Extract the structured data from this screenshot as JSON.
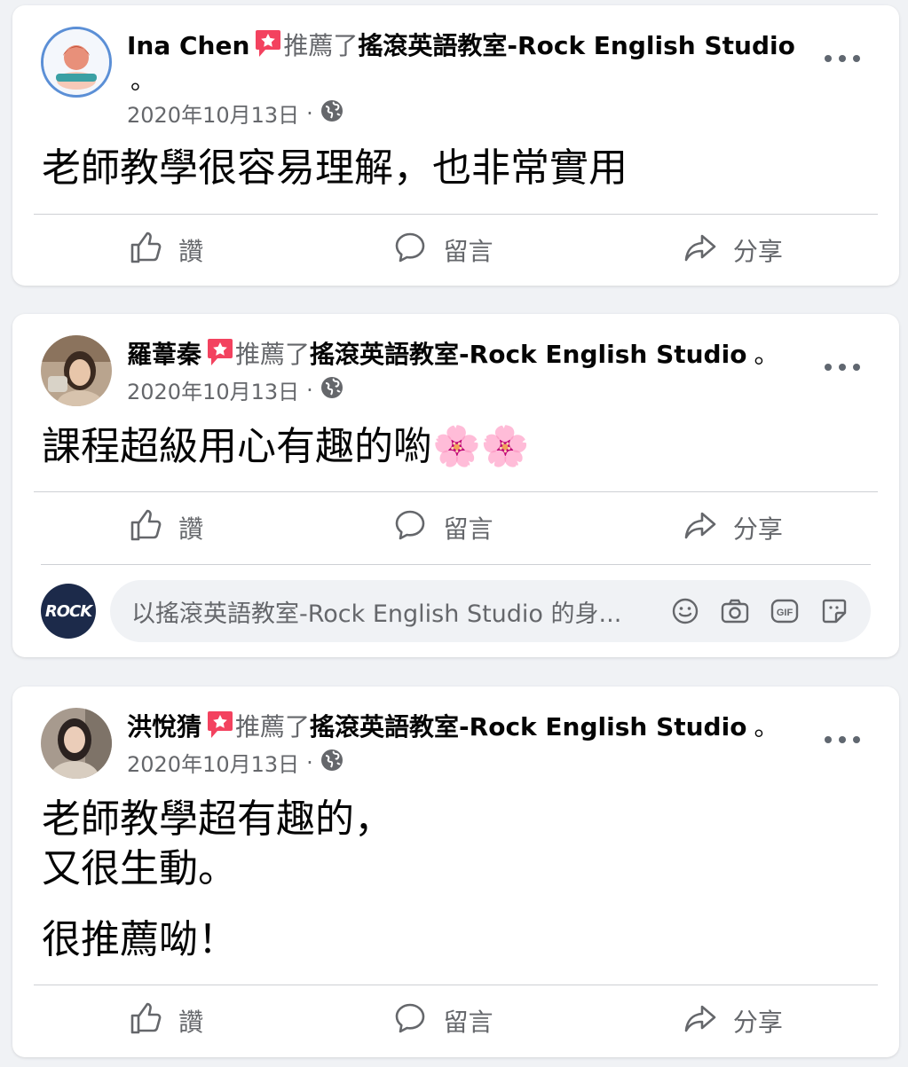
{
  "recommend_text": "推薦了",
  "page_name": "搖滾英語教室-Rock English Studio",
  "period": "。",
  "posts": [
    {
      "author": "Ina Chen",
      "date": "2020年10月13日",
      "sep": "·",
      "body_lines": [
        "老師教學很容易理解，也非常實用"
      ]
    },
    {
      "author": "羅葦秦",
      "date": "2020年10月13日",
      "sep": "·",
      "body_lines": [
        "課程超級用心有趣的喲🌸🌸"
      ]
    },
    {
      "author": "洪悅猜",
      "date": "2020年10月13日",
      "sep": "·",
      "body_lines": [
        "老師教學超有趣的，",
        "又很生動。",
        "很推薦呦！"
      ]
    }
  ],
  "actions": {
    "like": "讚",
    "comment": "留言",
    "share": "分享"
  },
  "comment_box": {
    "avatar_text": "ROCK",
    "placeholder": "以搖滾英語教室-Rock English Studio 的身..."
  },
  "colors": {
    "recommend_red": "#f3425f",
    "secondary_text": "#65676b",
    "brand_blue": "#1877f2"
  },
  "icons": [
    "recommend-star-icon",
    "globe-icon",
    "more-icon",
    "like-icon",
    "comment-icon",
    "share-icon",
    "emoji-icon",
    "camera-icon",
    "gif-icon",
    "sticker-icon"
  ]
}
